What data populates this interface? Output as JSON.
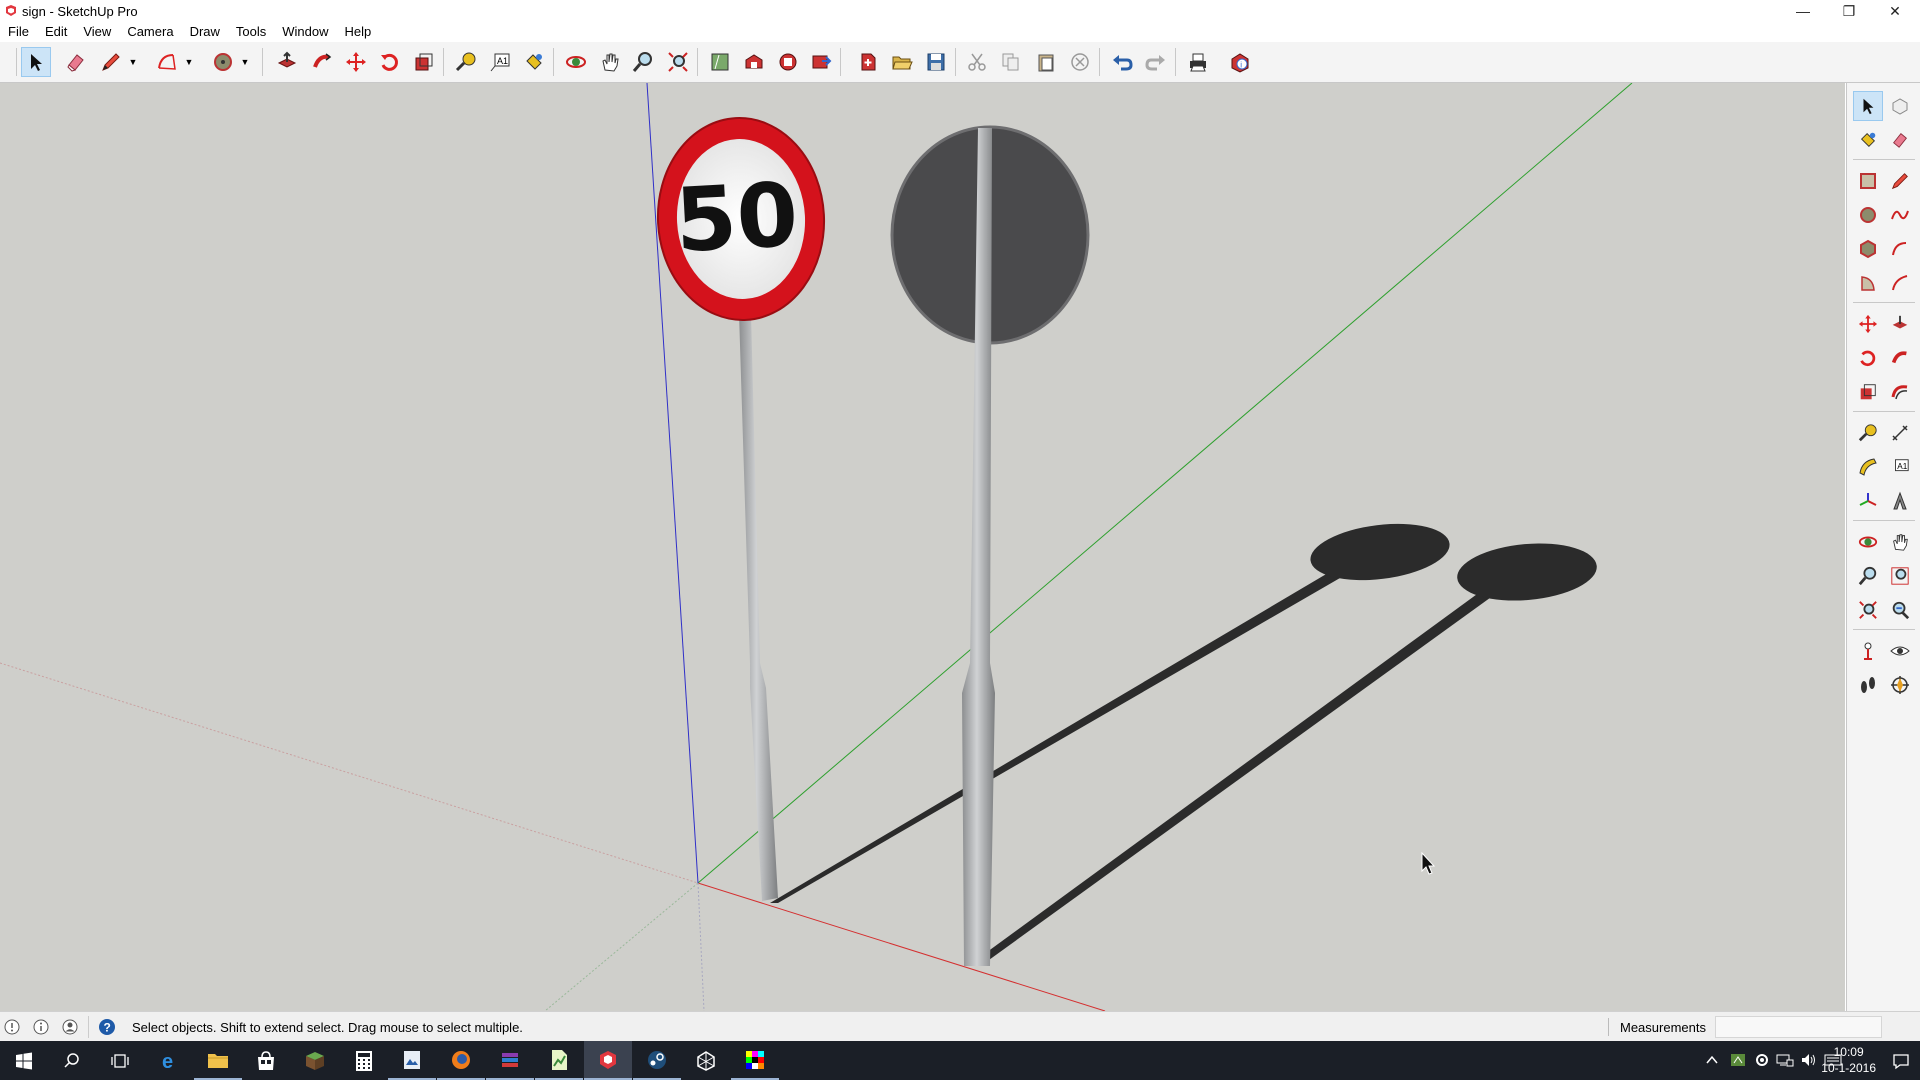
{
  "window": {
    "title": "sign - SketchUp Pro"
  },
  "menu": [
    "File",
    "Edit",
    "View",
    "Camera",
    "Draw",
    "Tools",
    "Window",
    "Help"
  ],
  "scene": {
    "sign_text": "50"
  },
  "status": {
    "text": "Select objects. Shift to extend select. Drag mouse to select multiple.",
    "measurements_label": "Measurements",
    "measurements_value": ""
  },
  "taskbar": {
    "time": "10:09",
    "date": "10-1-2016"
  },
  "colors": {
    "viewport_bg": "#cfcfcb",
    "sign_red": "#d4121c",
    "toolbar_bg": "#f4f4f4",
    "taskbar_bg": "#1b1f27"
  }
}
